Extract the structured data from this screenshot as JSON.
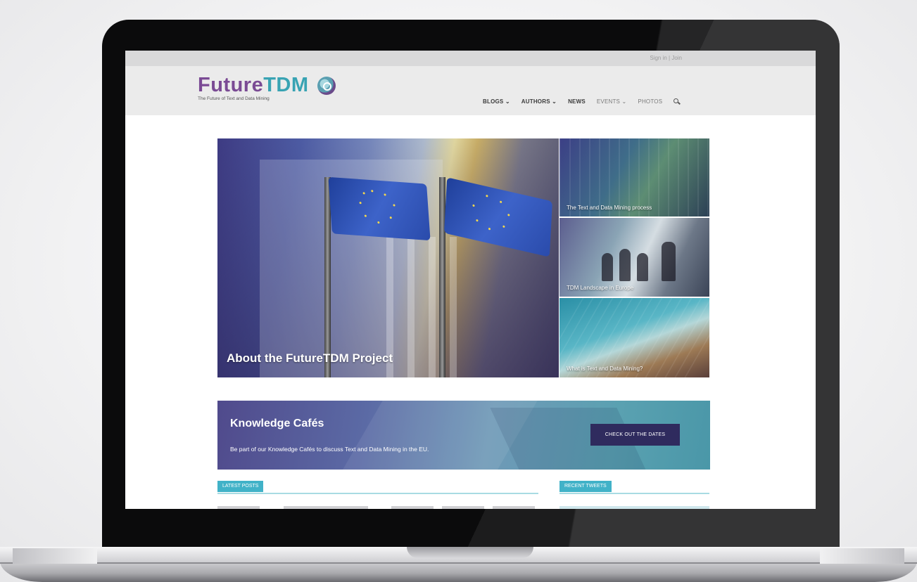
{
  "topbar": {
    "signin": "Sign in | Join"
  },
  "logo": {
    "title_future": "Future",
    "title_tdm": "TDM",
    "subtitle": "The Future of Text and Data Mining"
  },
  "nav": {
    "items": [
      "BLOGS ⌄",
      "AUTHORS ⌄",
      "NEWS",
      "EVENTS ⌄",
      "PHOTOS"
    ],
    "search_icon": "search-icon"
  },
  "hero": {
    "main_caption": "About the FutureTDM Project",
    "tiles": [
      "The Text and Data Mining process",
      "TDM Landscape in Europe",
      "What is Text and Data Mining?"
    ]
  },
  "banner": {
    "title": "Knowledge Cafés",
    "text": "Be part of our Knowledge Cafés to discuss Text and Data Mining in the EU.",
    "button": "CHECK OUT THE DATES"
  },
  "sections": {
    "latest_posts": "LATEST POSTS",
    "recent_tweets": "RECENT TWEETS"
  },
  "colors": {
    "brand_purple": "#7a4a94",
    "brand_teal": "#38a3b3",
    "accent": "#41b2c8",
    "button": "#2f2b5e"
  }
}
